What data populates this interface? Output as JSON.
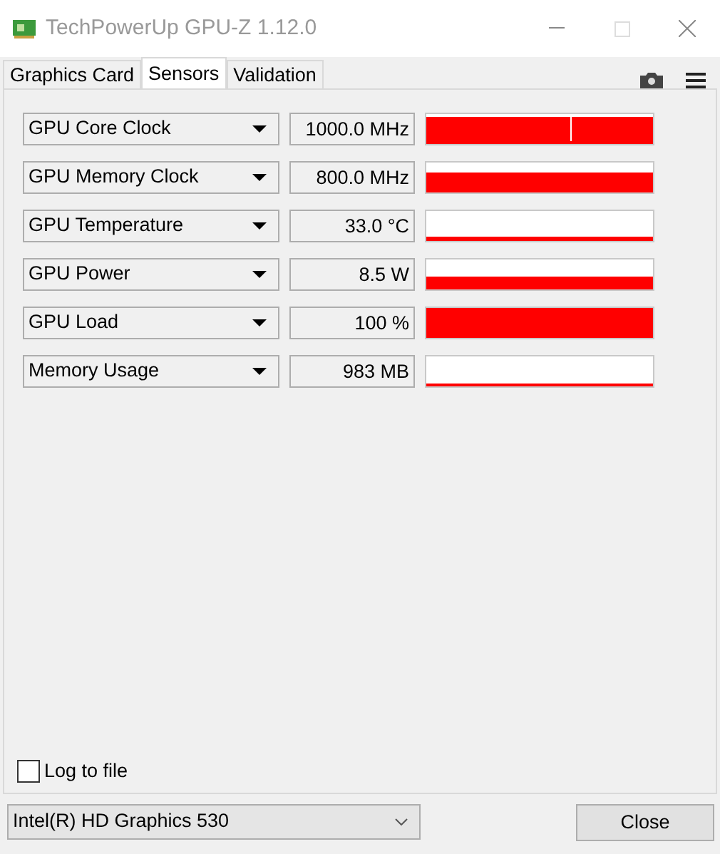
{
  "window": {
    "title": "TechPowerUp GPU-Z 1.12.0"
  },
  "tabs": [
    {
      "label": "Graphics Card",
      "selected": false
    },
    {
      "label": "Sensors",
      "selected": true
    },
    {
      "label": "Validation",
      "selected": false
    }
  ],
  "sensors": [
    {
      "name": "GPU Core Clock",
      "value": "1000.0 MHz"
    },
    {
      "name": "GPU Memory Clock",
      "value": "800.0 MHz"
    },
    {
      "name": "GPU Temperature",
      "value": "33.0 °C"
    },
    {
      "name": "GPU Power",
      "value": "8.5 W"
    },
    {
      "name": "GPU Load",
      "value": "100 %"
    },
    {
      "name": "Memory Usage",
      "value": "983 MB"
    }
  ],
  "log_to_file": {
    "label": "Log to file",
    "checked": false
  },
  "gpu_select": {
    "value": "Intel(R) HD Graphics 530"
  },
  "close_button": {
    "label": "Close"
  }
}
